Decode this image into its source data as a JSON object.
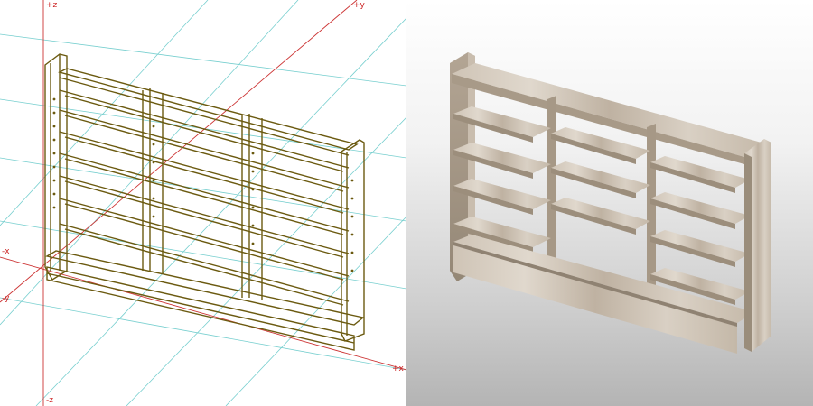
{
  "viewport_wireframe": {
    "axis_labels": {
      "plus_z": "+z",
      "plus_y": "+y",
      "minus_x": "-x",
      "minus_y": "-y",
      "plus_x": "+x",
      "minus_z": "-z"
    },
    "colors": {
      "wire": "#6b5a10",
      "axis": "#cc3333",
      "grid": "#77cfcf"
    }
  },
  "viewport_render": {
    "colors": {
      "wood_light": "#d6ccbf",
      "wood_mid": "#b9ab9a",
      "wood_dark": "#8f8272",
      "background": "#d8d8d8"
    }
  }
}
